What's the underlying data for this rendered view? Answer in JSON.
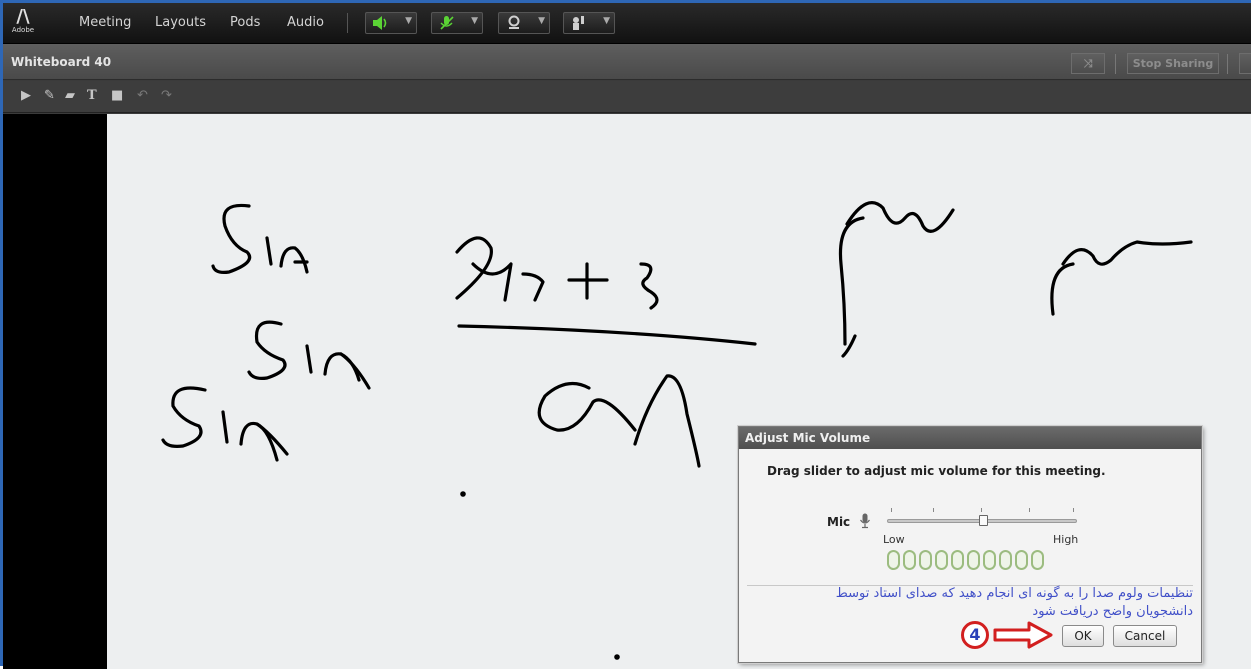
{
  "app": {
    "logo_text": "Adobe",
    "menu": [
      "Meeting",
      "Layouts",
      "Pods",
      "Audio"
    ],
    "toolbar_icons": [
      "speaker-icon",
      "mic-muted-icon",
      "webcam-icon",
      "raise-hand-icon"
    ]
  },
  "pod": {
    "title": "Whiteboard 40",
    "stop_sharing_label": "Stop Sharing"
  },
  "whiteboard_tools": [
    "select-icon",
    "pencil-icon",
    "highlighter-icon",
    "text-icon",
    "rectangle-icon",
    "undo-icon",
    "redo-icon"
  ],
  "canvas": {
    "handwriting": [
      "Sin",
      "Sin",
      "Sin"
    ],
    "background": "#edeff0"
  },
  "dialog": {
    "title": "Adjust Mic Volume",
    "instruction": "Drag slider to adjust mic volume for this meeting.",
    "mic_label": "Mic",
    "low_label": "Low",
    "high_label": "High",
    "slider_value": 0.5,
    "meter_segments": 10,
    "meter_active": 0,
    "annotation_line1": "تنظیمات ولوم صدا را به گونه ای انجام دهید که صدای استاد توسط",
    "annotation_line2": "دانشجویان واضح دریافت شود",
    "step_number": "4",
    "ok_label": "OK",
    "cancel_label": "Cancel"
  },
  "colors": {
    "frame_border": "#2e67b6",
    "annotation_text": "#4150c8",
    "step_badge_ring": "#d21f1f",
    "meter_outline": "#9cbc80",
    "speaker_active": "#5bd435"
  }
}
